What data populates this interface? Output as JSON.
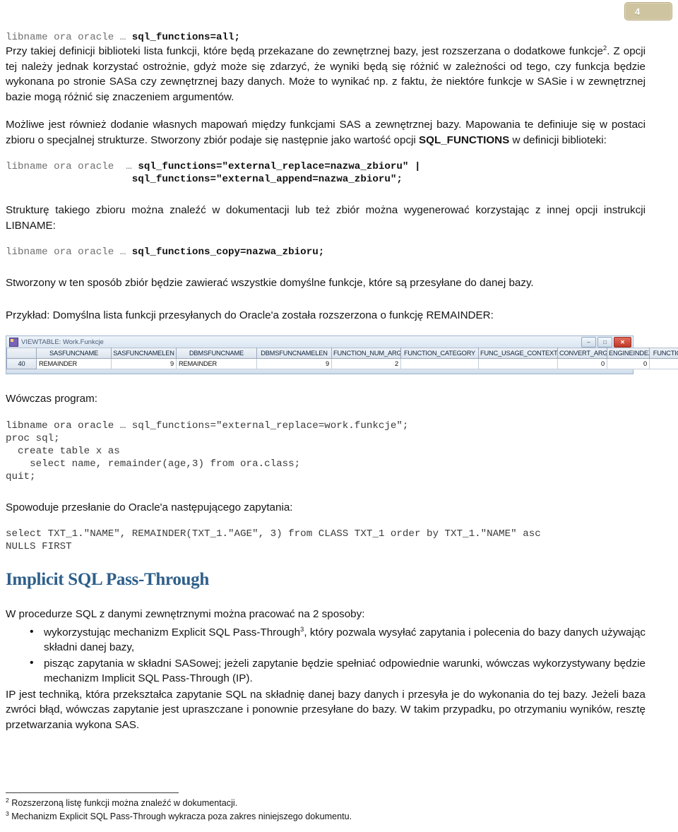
{
  "page": {
    "number": "4",
    "badge_color": "#cfc4a0"
  },
  "code_blocks": {
    "cb1_prefix": "libname ora oracle … ",
    "cb1_bold": "sql_functions=all;",
    "cb2_prefix": "libname ora oracle  … ",
    "cb2_bold_line1": "sql_functions=\"external_replace=nazwa_zbioru\" |",
    "cb2_bold_line2": "sql_functions=\"external_append=nazwa_zbioru\";",
    "cb3_prefix": "libname ora oracle … ",
    "cb3_bold": "sql_functions_copy=nazwa_zbioru;",
    "cb4_line1": "libname ora oracle … sql_functions=\"external_replace=work.funkcje\";",
    "cb4_line2": "proc sql;",
    "cb4_line3": "  create table x as",
    "cb4_line4": "    select name, remainder(age,3) from ora.class;",
    "cb4_line5": "quit;",
    "cb5_line1": "select TXT_1.\"NAME\", REMAINDER(TXT_1.\"AGE\", 3) from CLASS TXT_1 order by TXT_1.\"NAME\" asc",
    "cb5_line2": "NULLS FIRST"
  },
  "paragraphs": {
    "p1_a": "Przy takiej definicji biblioteki lista funkcji, które będą przekazane do zewnętrznej bazy, jest rozszerzana o dodatkowe funkcje",
    "p1_sup": "2",
    "p1_b": ". Z opcji tej należy jednak korzystać ostrożnie, gdyż może się zdarzyć, że wyniki będą się różnić w zależności od tego, czy funkcja będzie wykonana po stronie SASa czy zewnętrznej bazy danych. Może to wynikać np. z faktu, że niektóre funkcje w SASie i w zewnętrznej bazie mogą różnić się znaczeniem argumentów.",
    "p2_a": "Możliwe jest również dodanie własnych mapowań między funkcjami SAS a zewnętrznej bazy. Mapowania te definiuje się w postaci zbioru o specjalnej strukturze. Stworzony zbiór podaje się następnie jako wartość opcji ",
    "p2_bold": "SQL_FUNCTIONS",
    "p2_b": " w definicji biblioteki:",
    "p3": "Strukturę takiego zbioru można znaleźć w dokumentacji lub też zbiór można wygenerować korzystając z innej opcji instrukcji LIBNAME:",
    "p4": "Stworzony w ten sposób zbiór będzie zawierać wszystkie domyślne funkcje, które są przesyłane do danej bazy.",
    "p5": "Przykład: Domyślna lista funkcji przesyłanych do Oracle'a została rozszerzona o funkcję REMAINDER:",
    "p6": "Wówczas program:",
    "p7": "Spowoduje przesłanie do Oracle'a następującego zapytania:",
    "p8": "W procedurze SQL z danymi zewnętrznymi można pracować na 2 sposoby:",
    "p9": "IP jest techniką, która przekształca zapytanie SQL na składnię danej bazy danych i przesyła je do wykonania do tej bazy. Jeżeli baza zwróci błąd, wówczas zapytanie jest upraszczane i ponownie przesyłane do bazy. W takim przypadku, po otrzymaniu wyników, resztę przetwarzania wykona SAS."
  },
  "heading": {
    "implicit_sql": "Implicit SQL Pass-Through",
    "color": "#2e5f8a"
  },
  "bullets": [
    {
      "text_a": "wykorzystując mechanizm Explicit SQL Pass-Through",
      "sup": "3",
      "text_b": ", który pozwala wysyłać zapytania i polecenia do bazy danych używając składni danej bazy,"
    },
    {
      "text_a": "pisząc zapytania w składni SASowej; jeżeli zapytanie będzie spełniać odpowiednie warunki, wówczas wykorzystywany będzie mechanizm Implicit SQL Pass-Through (IP).",
      "sup": "",
      "text_b": ""
    }
  ],
  "footnotes": [
    {
      "marker": "2",
      "text": " Rozszerzoną listę funkcji można znaleźć w dokumentacji."
    },
    {
      "marker": "3",
      "text": " Mechanizm Explicit SQL Pass-Through wykracza poza zakres niniejszego dokumentu."
    }
  ],
  "viewtable": {
    "title": "VIEWTABLE: Work.Funkcje",
    "window_buttons": {
      "minimize": "–",
      "maximize": "□",
      "close": "✕"
    },
    "scroll_arrow": "▲",
    "columns": [
      "",
      "SASFUNCNAME",
      "SASFUNCNAMELEN",
      "DBMSFUNCNAME",
      "DBMSFUNCNAMELEN",
      "FUNCTION_NUM_ARGS",
      "FUNCTION_CATEGORY",
      "FUNC_USAGE_CONTEXT",
      "CONVERT_ARGS",
      "ENGINEINDEX",
      "FUNCTION_"
    ],
    "rows": [
      {
        "rownum": "40",
        "cells": [
          "REMAINDER",
          "9",
          "REMAINDER",
          "9",
          "2",
          "",
          "",
          "0",
          "0",
          ""
        ]
      }
    ]
  }
}
